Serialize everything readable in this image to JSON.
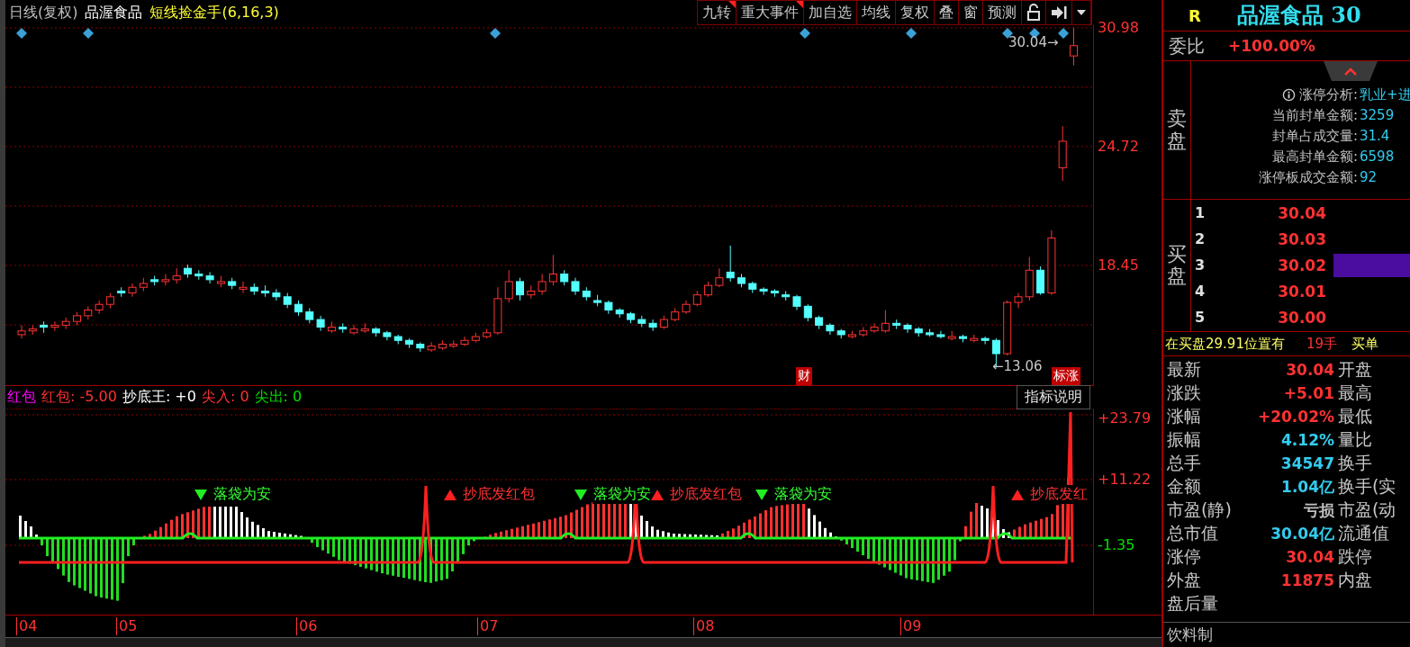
{
  "header": {
    "period": "日线(复权)",
    "stock": "品渥食品",
    "formula": "短线捡金手(6,16,3)"
  },
  "toolbar": [
    {
      "label": "九转",
      "flag": true
    },
    {
      "label": "重大事件",
      "flag": true
    },
    {
      "label": "加自选",
      "flag": false
    },
    {
      "label": "均线",
      "flag": false
    },
    {
      "label": "复权",
      "flag": false
    },
    {
      "label": "叠",
      "flag": false
    },
    {
      "label": "窗",
      "flag": false
    },
    {
      "label": "预测",
      "flag": false
    }
  ],
  "price_chart": {
    "high_label": "30.04→",
    "low_label": "←13.06",
    "badges": [
      "财",
      "标涨"
    ],
    "chart_data": {
      "type": "candlestick",
      "grid": true,
      "ylim": [
        12.14,
        31.12
      ],
      "yticks": [
        {
          "value": 30.98,
          "label": "30.98"
        },
        {
          "value": 24.72,
          "label": "24.72"
        },
        {
          "value": 18.45,
          "label": "18.45"
        }
      ],
      "ohlc": [
        [
          14.8,
          15.3,
          14.6,
          15.0
        ],
        [
          15.0,
          15.3,
          14.8,
          15.1
        ],
        [
          15.3,
          15.5,
          14.9,
          15.2
        ],
        [
          15.2,
          15.5,
          15.0,
          15.3
        ],
        [
          15.3,
          15.7,
          15.1,
          15.5
        ],
        [
          15.5,
          16.0,
          15.3,
          15.8
        ],
        [
          15.8,
          16.3,
          15.6,
          16.1
        ],
        [
          16.1,
          16.6,
          15.9,
          16.4
        ],
        [
          16.4,
          17.0,
          16.2,
          16.8
        ],
        [
          17.1,
          17.3,
          16.8,
          17.0
        ],
        [
          17.0,
          17.5,
          16.8,
          17.3
        ],
        [
          17.3,
          17.8,
          17.1,
          17.5
        ],
        [
          17.7,
          17.9,
          17.4,
          17.6
        ],
        [
          17.6,
          18.0,
          17.4,
          17.7
        ],
        [
          17.7,
          18.3,
          17.5,
          17.9
        ],
        [
          18.3,
          18.5,
          17.8,
          18.0
        ],
        [
          18.0,
          18.2,
          17.7,
          17.9
        ],
        [
          17.9,
          18.1,
          17.5,
          17.7
        ],
        [
          17.5,
          17.9,
          17.3,
          17.6
        ],
        [
          17.6,
          17.8,
          17.2,
          17.4
        ],
        [
          17.2,
          17.6,
          17.0,
          17.3
        ],
        [
          17.3,
          17.5,
          16.9,
          17.1
        ],
        [
          17.1,
          17.4,
          16.8,
          17.0
        ],
        [
          17.0,
          17.2,
          16.6,
          16.8
        ],
        [
          16.8,
          17.0,
          16.2,
          16.4
        ],
        [
          16.4,
          16.6,
          15.8,
          16.0
        ],
        [
          16.0,
          16.2,
          15.4,
          15.6
        ],
        [
          15.6,
          15.8,
          15.0,
          15.2
        ],
        [
          15.0,
          15.5,
          14.9,
          15.2
        ],
        [
          15.2,
          15.4,
          14.9,
          15.1
        ],
        [
          14.9,
          15.3,
          14.8,
          15.1
        ],
        [
          15.0,
          15.4,
          14.9,
          15.1
        ],
        [
          15.1,
          15.2,
          14.7,
          14.9
        ],
        [
          14.9,
          15.0,
          14.5,
          14.7
        ],
        [
          14.7,
          14.8,
          14.3,
          14.5
        ],
        [
          14.5,
          14.6,
          14.1,
          14.3
        ],
        [
          14.3,
          14.4,
          13.9,
          14.1
        ],
        [
          14.0,
          14.4,
          13.9,
          14.2
        ],
        [
          14.1,
          14.5,
          14.0,
          14.3
        ],
        [
          14.2,
          14.5,
          14.1,
          14.3
        ],
        [
          14.3,
          14.7,
          14.2,
          14.5
        ],
        [
          14.5,
          14.9,
          14.4,
          14.7
        ],
        [
          14.7,
          15.1,
          14.6,
          14.9
        ],
        [
          14.9,
          17.3,
          14.8,
          16.7
        ],
        [
          16.7,
          18.2,
          16.5,
          17.6
        ],
        [
          17.6,
          17.8,
          16.6,
          16.9
        ],
        [
          16.9,
          17.4,
          16.7,
          17.1
        ],
        [
          17.1,
          18.0,
          16.9,
          17.6
        ],
        [
          17.6,
          19.0,
          17.4,
          18.0
        ],
        [
          18.0,
          18.2,
          17.4,
          17.6
        ],
        [
          17.6,
          17.8,
          16.9,
          17.1
        ],
        [
          17.1,
          17.3,
          16.6,
          16.8
        ],
        [
          16.6,
          16.9,
          16.3,
          16.5
        ],
        [
          16.5,
          16.6,
          15.9,
          16.1
        ],
        [
          16.1,
          16.2,
          15.7,
          15.9
        ],
        [
          15.9,
          16.0,
          15.4,
          15.6
        ],
        [
          15.6,
          15.8,
          15.2,
          15.4
        ],
        [
          15.4,
          15.6,
          15.0,
          15.2
        ],
        [
          15.2,
          15.8,
          15.1,
          15.6
        ],
        [
          15.6,
          16.2,
          15.5,
          16.0
        ],
        [
          16.0,
          16.6,
          15.9,
          16.4
        ],
        [
          16.4,
          17.1,
          16.3,
          16.9
        ],
        [
          16.9,
          17.6,
          16.8,
          17.4
        ],
        [
          17.4,
          18.3,
          17.3,
          17.8
        ],
        [
          18.1,
          19.5,
          17.6,
          17.8
        ],
        [
          17.8,
          18.0,
          17.3,
          17.5
        ],
        [
          17.5,
          17.6,
          17.0,
          17.2
        ],
        [
          17.2,
          17.3,
          16.9,
          17.1
        ],
        [
          17.1,
          17.2,
          16.8,
          17.0
        ],
        [
          16.9,
          17.1,
          16.6,
          16.8
        ],
        [
          16.8,
          16.9,
          16.1,
          16.3
        ],
        [
          16.3,
          16.4,
          15.5,
          15.7
        ],
        [
          15.7,
          15.8,
          15.1,
          15.3
        ],
        [
          15.3,
          15.4,
          14.8,
          15.0
        ],
        [
          15.0,
          15.1,
          14.6,
          14.8
        ],
        [
          14.7,
          15.0,
          14.6,
          14.8
        ],
        [
          14.8,
          15.2,
          14.7,
          15.0
        ],
        [
          15.0,
          15.4,
          14.9,
          15.2
        ],
        [
          15.0,
          16.1,
          14.9,
          15.4
        ],
        [
          15.4,
          15.6,
          15.1,
          15.3
        ],
        [
          15.3,
          15.4,
          14.9,
          15.1
        ],
        [
          15.1,
          15.2,
          14.7,
          14.9
        ],
        [
          14.9,
          15.1,
          14.7,
          14.8
        ],
        [
          14.8,
          15.0,
          14.6,
          14.7
        ],
        [
          14.6,
          15.0,
          14.5,
          14.7
        ],
        [
          14.7,
          14.8,
          14.4,
          14.6
        ],
        [
          14.5,
          14.8,
          14.4,
          14.6
        ],
        [
          14.6,
          14.7,
          14.3,
          14.5
        ],
        [
          14.5,
          14.6,
          13.06,
          13.8
        ],
        [
          13.8,
          16.6,
          13.7,
          16.5
        ],
        [
          16.5,
          17.0,
          16.2,
          16.8
        ],
        [
          16.8,
          18.9,
          16.6,
          18.2
        ],
        [
          18.2,
          18.4,
          16.9,
          17.0
        ],
        [
          17.0,
          20.3,
          16.9,
          19.9
        ],
        [
          23.6,
          25.8,
          22.9,
          25.0
        ],
        [
          29.5,
          30.98,
          29.0,
          30.04
        ]
      ]
    }
  },
  "indicator": {
    "legend": [
      {
        "text": "红包",
        "color": "#ff00ff"
      },
      {
        "text": "红包: -5.00",
        "color": "#ff3232"
      },
      {
        "text": "抄底王: +0",
        "color": "#ffffff"
      },
      {
        "text": "尖入: 0",
        "color": "#ff3232"
      },
      {
        "text": "尖出: 0",
        "color": "#00e000"
      }
    ],
    "button": "指标说明",
    "axis": [
      "+23.79",
      "+11.22",
      "-1.35"
    ],
    "signals": [
      {
        "kind": "sell",
        "label": "落袋为安"
      },
      {
        "kind": "buy",
        "label": "抄底发红包"
      },
      {
        "kind": "sell",
        "label": "落袋为安"
      },
      {
        "kind": "buy",
        "label": "抄底发红包"
      },
      {
        "kind": "sell",
        "label": "落袋为安"
      },
      {
        "kind": "buy",
        "label": "抄底发红"
      }
    ]
  },
  "date_axis": [
    "04",
    "05",
    "06",
    "07",
    "08",
    "09"
  ],
  "quote": {
    "marker": "R",
    "title": "品渥食品 30",
    "weibi_label": "委比",
    "weibi": "+100.00%",
    "sell_label": "卖盘",
    "analysis": [
      {
        "label": "涨停分析:",
        "value": "乳业+进",
        "kind": "header"
      },
      {
        "label": "当前封单金额:",
        "value": "3259",
        "kind": "row"
      },
      {
        "label": "封单占成交量:",
        "value": "31.4",
        "kind": "row"
      },
      {
        "label": "最高封单金额:",
        "value": "6598",
        "kind": "row"
      },
      {
        "label": "涨停板成交金额:",
        "value": "92",
        "kind": "row"
      }
    ],
    "buy_label": "买盘",
    "bids": [
      {
        "rank": "1",
        "price": "30.04"
      },
      {
        "rank": "2",
        "price": "30.03"
      },
      {
        "rank": "3",
        "price": "30.02",
        "level": 1
      },
      {
        "rank": "4",
        "price": "30.01"
      },
      {
        "rank": "5",
        "price": "30.00"
      }
    ],
    "notice": {
      "text": "在买盘29.91位置有",
      "volume": "19手",
      "tail": "买单"
    },
    "stats": [
      {
        "label": "最新",
        "value": "30.04",
        "color": "#ff3232",
        "label2": "开盘"
      },
      {
        "label": "涨跌",
        "value": "+5.01",
        "color": "#ff3232",
        "label2": "最高"
      },
      {
        "label": "涨幅",
        "value": "+20.02%",
        "color": "#ff3232",
        "label2": "最低"
      },
      {
        "label": "振幅",
        "value": "4.12%",
        "color": "#33ccee",
        "label2": "量比"
      },
      {
        "label": "总手",
        "value": "34547",
        "color": "#33ccee",
        "label2": "换手"
      },
      {
        "label": "金额",
        "value": "1.04亿",
        "color": "#33ccee",
        "label2": "换手(实"
      },
      {
        "label": "市盈(静)",
        "value": "亏损",
        "color": "#c0c0c0",
        "label2": "市盈(动"
      },
      {
        "label": "总市值",
        "value": "30.04亿",
        "color": "#33ccee",
        "label2": "流通值"
      },
      {
        "label": "涨停",
        "value": "30.04",
        "color": "#ff3232",
        "label2": "跌停"
      },
      {
        "label": "外盘",
        "value": "11875",
        "color": "#ff3232",
        "label2": "内盘"
      },
      {
        "label": "盘后量"
      }
    ],
    "sector": "饮料制"
  }
}
